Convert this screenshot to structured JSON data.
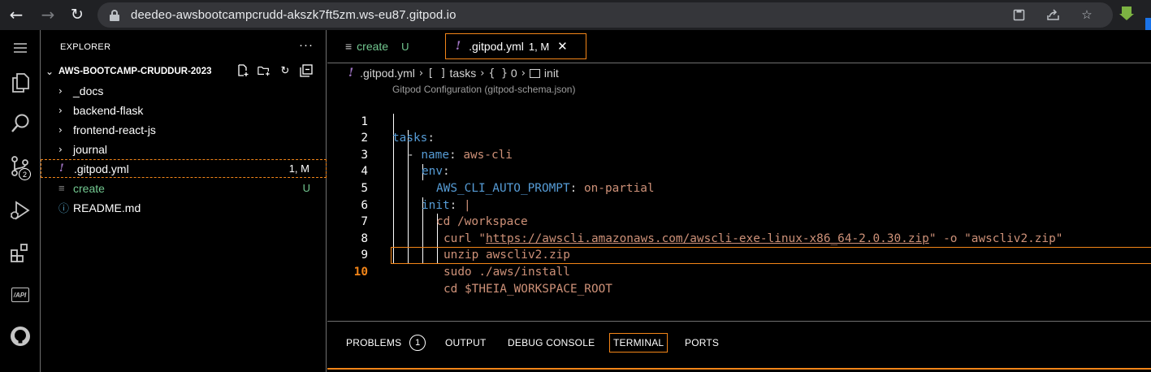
{
  "browser": {
    "url": "deedeo-awsbootcampcrudd-akszk7ft5zm.ws-eu87.gitpod.io",
    "back_icon": "back-arrow-icon",
    "forward_icon": "forward-arrow-icon",
    "reload_icon": "reload-icon"
  },
  "activity_bar": {
    "scm_badge": "2",
    "items": [
      "menu-icon",
      "files-icon",
      "search-icon",
      "source-control-icon",
      "run-debug-icon",
      "extensions-icon",
      "api-icon",
      "github-icon"
    ],
    "api_label": "/API"
  },
  "sidebar": {
    "title": "EXPLORER",
    "more": "···",
    "folder": "AWS-BOOTCAMP-CRUDDUR-2023",
    "items": [
      {
        "label": "_docs",
        "type": "folder",
        "status": ""
      },
      {
        "label": "backend-flask",
        "type": "folder",
        "status": ""
      },
      {
        "label": "frontend-react-js",
        "type": "folder",
        "status": ""
      },
      {
        "label": "journal",
        "type": "folder",
        "status": ""
      },
      {
        "label": ".gitpod.yml",
        "type": "yaml",
        "status": "1, M"
      },
      {
        "label": "create",
        "type": "text",
        "status": "U"
      },
      {
        "label": "README.md",
        "type": "markdown",
        "status": ""
      }
    ]
  },
  "editor": {
    "tabs": [
      {
        "label": "create",
        "status": "U",
        "active": false
      },
      {
        "label": ".gitpod.yml",
        "status": "1, M",
        "active": true
      }
    ],
    "breadcrumb": {
      "file": ".gitpod.yml",
      "tasks_sym": "[ ]",
      "tasks": "tasks",
      "index_sym": "{ }",
      "index": "0",
      "init": "init"
    },
    "schema_hint": "Gitpod Configuration (gitpod-schema.json)",
    "current_line": 10,
    "lines": [
      {
        "n": "1",
        "k": "tasks",
        "rest": ":"
      },
      {
        "n": "2",
        "dash": "- ",
        "k": "name",
        "rest": ": ",
        "v": "aws-cli"
      },
      {
        "n": "3",
        "k": "env",
        "rest": ":"
      },
      {
        "n": "4",
        "k": "AWS_CLI_AUTO_PROMPT",
        "rest": ": ",
        "v": "on-partial"
      },
      {
        "n": "5",
        "k": "init",
        "rest": ": ",
        "v": "|"
      },
      {
        "n": "6",
        "v": "cd /workspace"
      },
      {
        "n": "7",
        "v1": "curl \"",
        "url": "https://awscli.amazonaws.com/awscli-exe-linux-x86_64-2.0.30.zip",
        "v2": "\" -o \"awscliv2.zip\""
      },
      {
        "n": "8",
        "v": "unzip awscliv2.zip"
      },
      {
        "n": "9",
        "v": "sudo ./aws/install"
      },
      {
        "n": "10",
        "v": "cd $THEIA_WORKSPACE_ROOT"
      }
    ]
  },
  "panel": {
    "tabs": [
      "PROBLEMS",
      "OUTPUT",
      "DEBUG CONSOLE",
      "TERMINAL",
      "PORTS"
    ],
    "problems_count": "1",
    "active": "TERMINAL"
  },
  "colors": {
    "focus_border": "#f38518",
    "keyword": "#569cd6",
    "string": "#ce9178",
    "untracked": "#73c991",
    "yaml_icon": "#a074c4"
  }
}
